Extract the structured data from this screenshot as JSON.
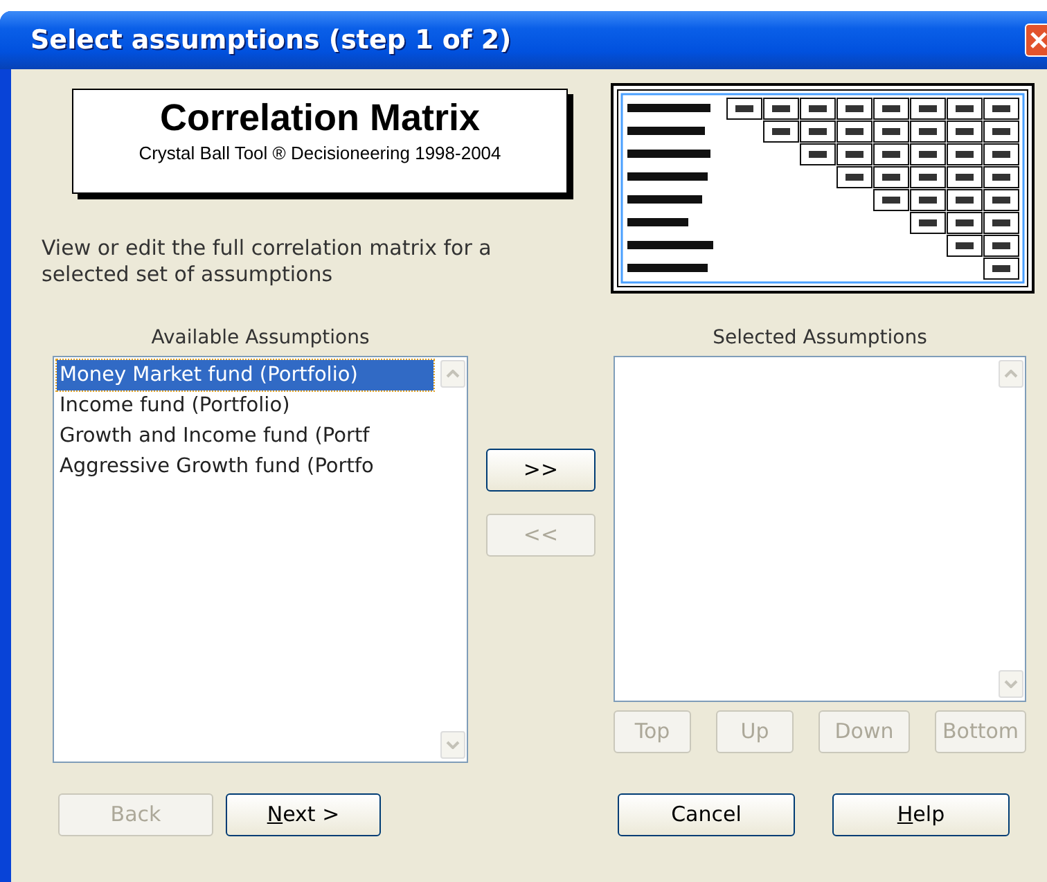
{
  "window": {
    "title": "Select assumptions (step 1 of 2)"
  },
  "banner": {
    "title": "Correlation Matrix",
    "subtitle": "Crystal Ball Tool ® Decisioneering 1998-2004"
  },
  "description": "View or edit the full correlation matrix for a selected set of assumptions",
  "available": {
    "label": "Available Assumptions",
    "items": [
      {
        "text": "Money Market fund (Portfolio)",
        "selected": true
      },
      {
        "text": "Income fund (Portfolio)",
        "selected": false
      },
      {
        "text": "Growth and Income fund (Portf",
        "selected": false
      },
      {
        "text": "Aggressive Growth fund (Portfo",
        "selected": false
      }
    ]
  },
  "transfer_buttons": [
    {
      "label": ">>",
      "disabled": false
    },
    {
      "label": "<<",
      "disabled": true
    }
  ],
  "selected_assumptions": {
    "label": "Selected Assumptions"
  },
  "order_buttons": [
    {
      "label": "Top",
      "disabled": true
    },
    {
      "label": "Up",
      "disabled": true
    },
    {
      "label": "Down",
      "disabled": true
    },
    {
      "label": "Bottom",
      "disabled": true
    }
  ],
  "nav_buttons": [
    {
      "label": "Back",
      "disabled": true
    },
    {
      "label": "Next >",
      "disabled": false,
      "underline_first": true
    }
  ],
  "dialog_buttons": [
    {
      "label": "Cancel",
      "disabled": false
    },
    {
      "label": "Help",
      "disabled": false,
      "underline_first": true
    }
  ]
}
